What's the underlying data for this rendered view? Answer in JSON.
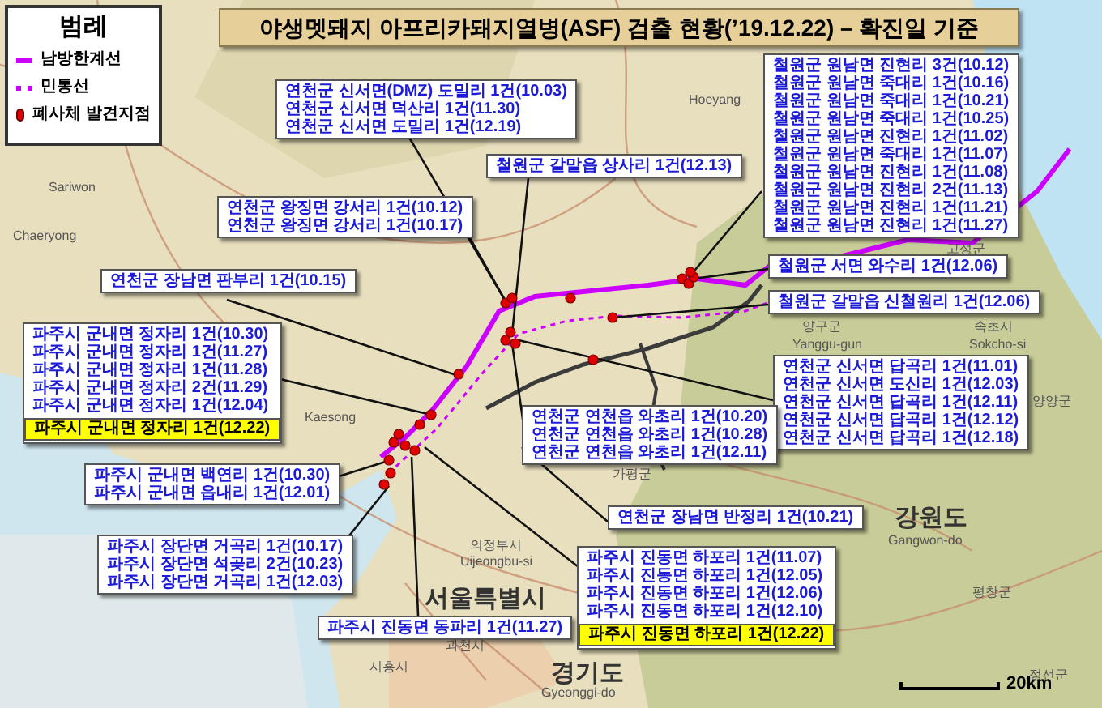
{
  "title": "야생멧돼지 아프리카돼지열병(ASF) 검출 현황(’19.12.22) – 확진일 기준",
  "legend": {
    "title": "범례",
    "items": [
      {
        "kind": "border-line",
        "label": "남방한계선"
      },
      {
        "kind": "control-line",
        "label": "민통선"
      },
      {
        "kind": "find-site",
        "label": "폐사체 발견지점"
      }
    ]
  },
  "callouts": [
    {
      "lines": [
        {
          "text": "철원군 원남면 진현리 3건(10.12)",
          "highlighted": false
        },
        {
          "text": "철원군 원남면 죽대리 1건(10.16)",
          "highlighted": false
        },
        {
          "text": "철원군 원남면 죽대리 1건(10.21)",
          "highlighted": false
        },
        {
          "text": "철원군 원남면 죽대리 1건(10.25)",
          "highlighted": false
        },
        {
          "text": "철원군 원남면 진현리 1건(11.02)",
          "highlighted": false
        },
        {
          "text": "철원군 원남면 죽대리 1건(11.07)",
          "highlighted": false
        },
        {
          "text": "철원군 원남면 진현리 1건(11.08)",
          "highlighted": false
        },
        {
          "text": "철원군 원남면 진현리 2건(11.13)",
          "highlighted": false
        },
        {
          "text": "철원군 원남면 진현리 1건(11.21)",
          "highlighted": false
        },
        {
          "text": "철원군 원남면 진현리 1건(11.27)",
          "highlighted": false
        }
      ]
    },
    {
      "lines": [
        {
          "text": "연천군 신서면(DMZ) 도밀리 1건(10.03)",
          "highlighted": false
        },
        {
          "text": "연천군 신서면 덕산리 1건(11.30)",
          "highlighted": false
        },
        {
          "text": "연천군 신서면 도밀리 1건(12.19)",
          "highlighted": false
        }
      ]
    },
    {
      "lines": [
        {
          "text": "철원군 갈말읍 상사리 1건(12.13)",
          "highlighted": false
        }
      ]
    },
    {
      "lines": [
        {
          "text": "연천군 왕징면 강서리 1건(10.12)",
          "highlighted": false
        },
        {
          "text": "연천군 왕징면 강서리 1건(10.17)",
          "highlighted": false
        }
      ]
    },
    {
      "lines": [
        {
          "text": "철원군 서면 와수리 1건(12.06)",
          "highlighted": false
        }
      ]
    },
    {
      "lines": [
        {
          "text": "연천군 장남면 판부리 1건(10.15)",
          "highlighted": false
        }
      ]
    },
    {
      "lines": [
        {
          "text": "철원군 갈말읍 신철원리 1건(12.06)",
          "highlighted": false
        }
      ]
    },
    {
      "lines": [
        {
          "text": "파주시 군내면 정자리 1건(10.30)",
          "highlighted": false
        },
        {
          "text": "파주시 군내면 정자리 1건(11.27)",
          "highlighted": false
        },
        {
          "text": "파주시 군내면 정자리 1건(11.28)",
          "highlighted": false
        },
        {
          "text": "파주시 군내면 정자리 2건(11.29)",
          "highlighted": false
        },
        {
          "text": "파주시 군내면 정자리 1건(12.04)",
          "highlighted": false
        },
        {
          "text": "파주시 군내면 정자리 1건(12.22)",
          "highlighted": true
        }
      ]
    },
    {
      "lines": [
        {
          "text": "연천군 신서면 답곡리 1건(11.01)",
          "highlighted": false
        },
        {
          "text": "연천군 신서면 도신리 1건(12.03)",
          "highlighted": false
        },
        {
          "text": "연천군 신서면 답곡리 1건(12.11)",
          "highlighted": false
        },
        {
          "text": "연천군 신서면 답곡리 1건(12.12)",
          "highlighted": false
        },
        {
          "text": "연천군 신서면 답곡리 1건(12.18)",
          "highlighted": false
        }
      ]
    },
    {
      "lines": [
        {
          "text": "연천군 연천읍 와초리 1건(10.20)",
          "highlighted": false
        },
        {
          "text": "연천군 연천읍 와초리 1건(10.28)",
          "highlighted": false
        },
        {
          "text": "연천군 연천읍 와초리 1건(12.11)",
          "highlighted": false
        }
      ]
    },
    {
      "lines": [
        {
          "text": "파주시 군내면 백연리 1건(10.30)",
          "highlighted": false
        },
        {
          "text": "파주시 군내면 읍내리 1건(12.01)",
          "highlighted": false
        }
      ]
    },
    {
      "lines": [
        {
          "text": "연천군 장남면 반정리 1건(10.21)",
          "highlighted": false
        }
      ]
    },
    {
      "lines": [
        {
          "text": "파주시 장단면 거곡리 1건(10.17)",
          "highlighted": false
        },
        {
          "text": "파주시 장단면 석곶리 2건(10.23)",
          "highlighted": false
        },
        {
          "text": "파주시 장단면 거곡리 1건(12.03)",
          "highlighted": false
        }
      ]
    },
    {
      "lines": [
        {
          "text": "파주시 진동면 동파리 1건(11.27)",
          "highlighted": false
        }
      ]
    },
    {
      "lines": [
        {
          "text": "파주시 진동면 하포리 1건(11.07)",
          "highlighted": false
        },
        {
          "text": "파주시 진동면 하포리 1건(12.05)",
          "highlighted": false
        },
        {
          "text": "파주시 진동면 하포리 1건(12.06)",
          "highlighted": false
        },
        {
          "text": "파주시 진동면 하포리 1건(12.10)",
          "highlighted": false
        },
        {
          "text": "파주시 진동면 하포리 1건(12.22)",
          "highlighted": true
        }
      ]
    }
  ],
  "place_labels": [
    {
      "kind": "place",
      "text": "Sariwon"
    },
    {
      "kind": "place",
      "text": "Chaeryong"
    },
    {
      "kind": "place",
      "text": "Hoeyang"
    },
    {
      "kind": "place",
      "text": "Kaesong"
    },
    {
      "kind": "place",
      "text": "고성군"
    },
    {
      "kind": "place",
      "text": "양구군"
    },
    {
      "kind": "place",
      "text": "Yanggu-gun"
    },
    {
      "kind": "place",
      "text": "속초시"
    },
    {
      "kind": "place",
      "text": "Sokcho-si"
    },
    {
      "kind": "place",
      "text": "양양군"
    },
    {
      "kind": "place",
      "text": "가평군"
    },
    {
      "kind": "place",
      "text": "의정부시"
    },
    {
      "kind": "place",
      "text": "Uijeongbu-si"
    },
    {
      "kind": "region",
      "text": "서울특별시"
    },
    {
      "kind": "region",
      "text": "강원도"
    },
    {
      "kind": "place",
      "text": "Gangwon-do"
    },
    {
      "kind": "place",
      "text": "과천시"
    },
    {
      "kind": "place",
      "text": "시흥시"
    },
    {
      "kind": "region",
      "text": "경기도"
    },
    {
      "kind": "place",
      "text": "Gyeonggi-do"
    },
    {
      "kind": "place",
      "text": "평창군"
    },
    {
      "kind": "place",
      "text": "정선군"
    }
  ],
  "scale_bar": {
    "label": "20km"
  }
}
